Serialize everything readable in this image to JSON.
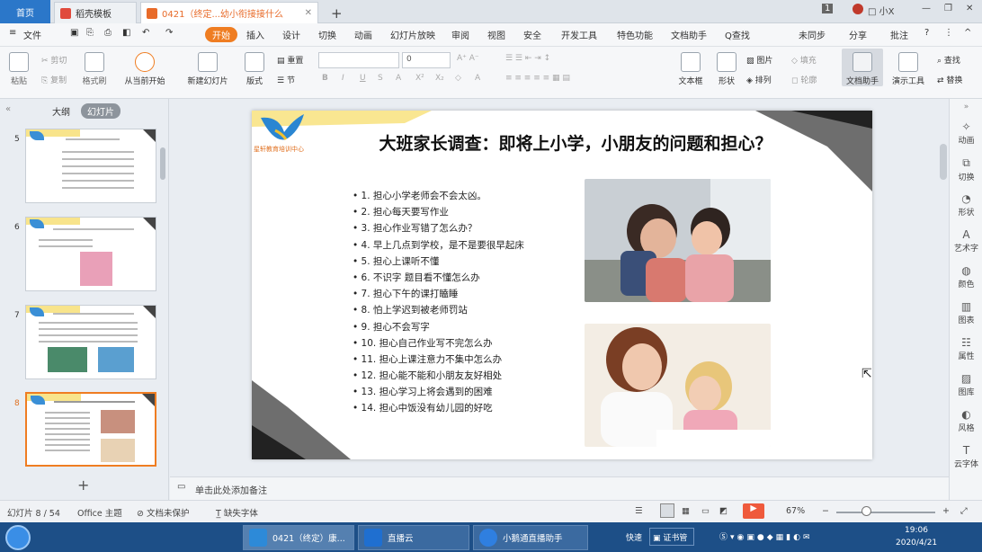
{
  "tabs": {
    "home": "首页",
    "templates": "稻壳模板",
    "doc": "0421（终定...幼小衔接接什么",
    "badge": "1",
    "user": "□ 小X"
  },
  "menu": [
    "文件",
    "开始",
    "插入",
    "设计",
    "切换",
    "动画",
    "幻灯片放映",
    "审阅",
    "视图",
    "安全",
    "开发工具",
    "特色功能",
    "文档助手"
  ],
  "menu_right": {
    "search": "Q查找",
    "sync": "未同步",
    "share": "分享",
    "comment": "批注"
  },
  "ribbon": {
    "paste": "粘贴",
    "cut": "剪切",
    "copy": "复制",
    "format_painter": "格式刷",
    "from_current": "从当前开始",
    "new_slide": "新建幻灯片",
    "layout": "版式",
    "reset": "重置",
    "section": "节",
    "font_size": "0",
    "textbox": "文本框",
    "shape": "形状",
    "arrange": "排列",
    "picture": "图片",
    "fill": "填充",
    "outline": "轮廓",
    "doc_assistant": "文档助手",
    "present_tool": "演示工具",
    "find": "查找",
    "replace": "替换"
  },
  "left_panel": {
    "tab_outline": "大纲",
    "tab_slides": "幻灯片",
    "add": "+"
  },
  "thumbs": [
    {
      "num": "5"
    },
    {
      "num": "6"
    },
    {
      "num": "7"
    },
    {
      "num": "8"
    }
  ],
  "slide": {
    "logo_text": "星轩教育培训中心",
    "title": "大班家长调查：即将上小学，小朋友的问题和担心？",
    "items": [
      "1. 担心小学老师会不会太凶。",
      "2. 担心每天要写作业",
      "3. 担心作业写错了怎么办？",
      "4. 早上几点到学校，是不是要很早起床",
      "5. 担心上课听不懂",
      "6. 不识字 题目看不懂怎么办",
      "7. 担心下午的课打瞌睡",
      "8. 怕上学迟到被老师罚站",
      "9. 担心不会写字",
      "10. 担心自己作业写不完怎么办",
      "11. 担心上课注意力不集中怎么办",
      "12. 担心能不能和小朋友友好相处",
      "13. 担心学习上将会遇到的困难",
      "14. 担心中饭没有幼儿园的好吃"
    ]
  },
  "notes_placeholder": "单击此处添加备注",
  "right_panel": [
    "动画",
    "切换",
    "形状",
    "艺术字",
    "颜色",
    "图表",
    "属性",
    "图库",
    "风格",
    "云字体"
  ],
  "status": {
    "slide_count": "幻灯片 8 / 54",
    "theme": "Office 主题",
    "protect": "文档未保护",
    "missing_font": "缺失字体",
    "zoom": "67%"
  },
  "taskbar": {
    "app1": "0421（终定）康...",
    "app2": "直播云",
    "app3": "小鹅通直播助手",
    "quick": "快速",
    "tray_app": "证书管",
    "time": "19:06",
    "date": "2020/4/21"
  },
  "colors": {
    "accent": "#ef7d22",
    "brand_blue": "#2b77c9",
    "taskbar": "#1d4f87"
  }
}
